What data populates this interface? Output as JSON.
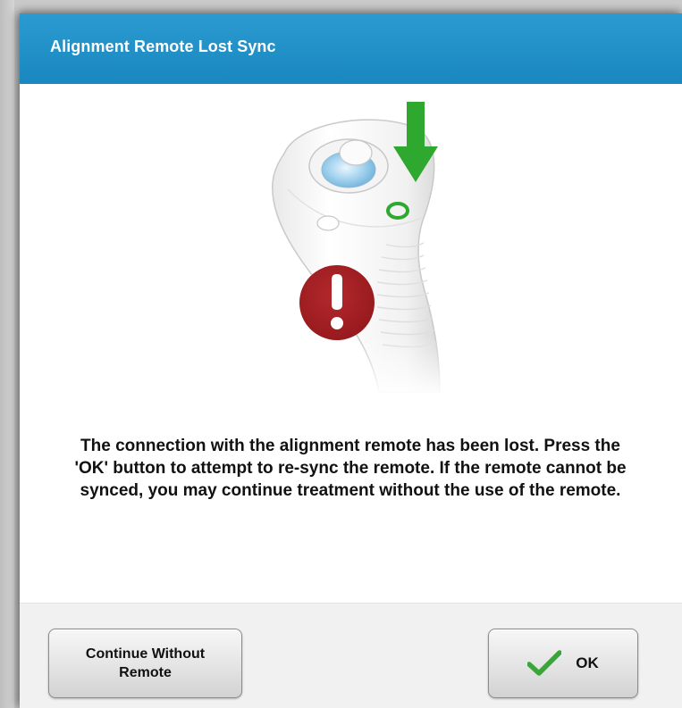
{
  "dialog": {
    "title": "Alignment Remote Lost Sync",
    "message": "The connection with the alignment remote has been lost. Press the 'OK' button to attempt to re-sync the remote. If the remote cannot be synced, you may continue treatment without the use of the remote."
  },
  "illustration": {
    "remote_icon": "alignment-remote-icon",
    "arrow_icon": "arrow-down-icon",
    "indicator_icon": "sync-indicator-ring-icon",
    "alert_icon": "exclamation-alert-icon",
    "arrow_color": "#2fa82f",
    "alert_color": "#a32328"
  },
  "buttons": {
    "continue_line1": "Continue Without",
    "continue_line2": "Remote",
    "ok_label": "OK",
    "ok_icon": "checkmark-icon",
    "check_color": "#3aa63a"
  },
  "colors": {
    "title_bar": "#1f8fc7",
    "footer": "#f1f1f1"
  }
}
